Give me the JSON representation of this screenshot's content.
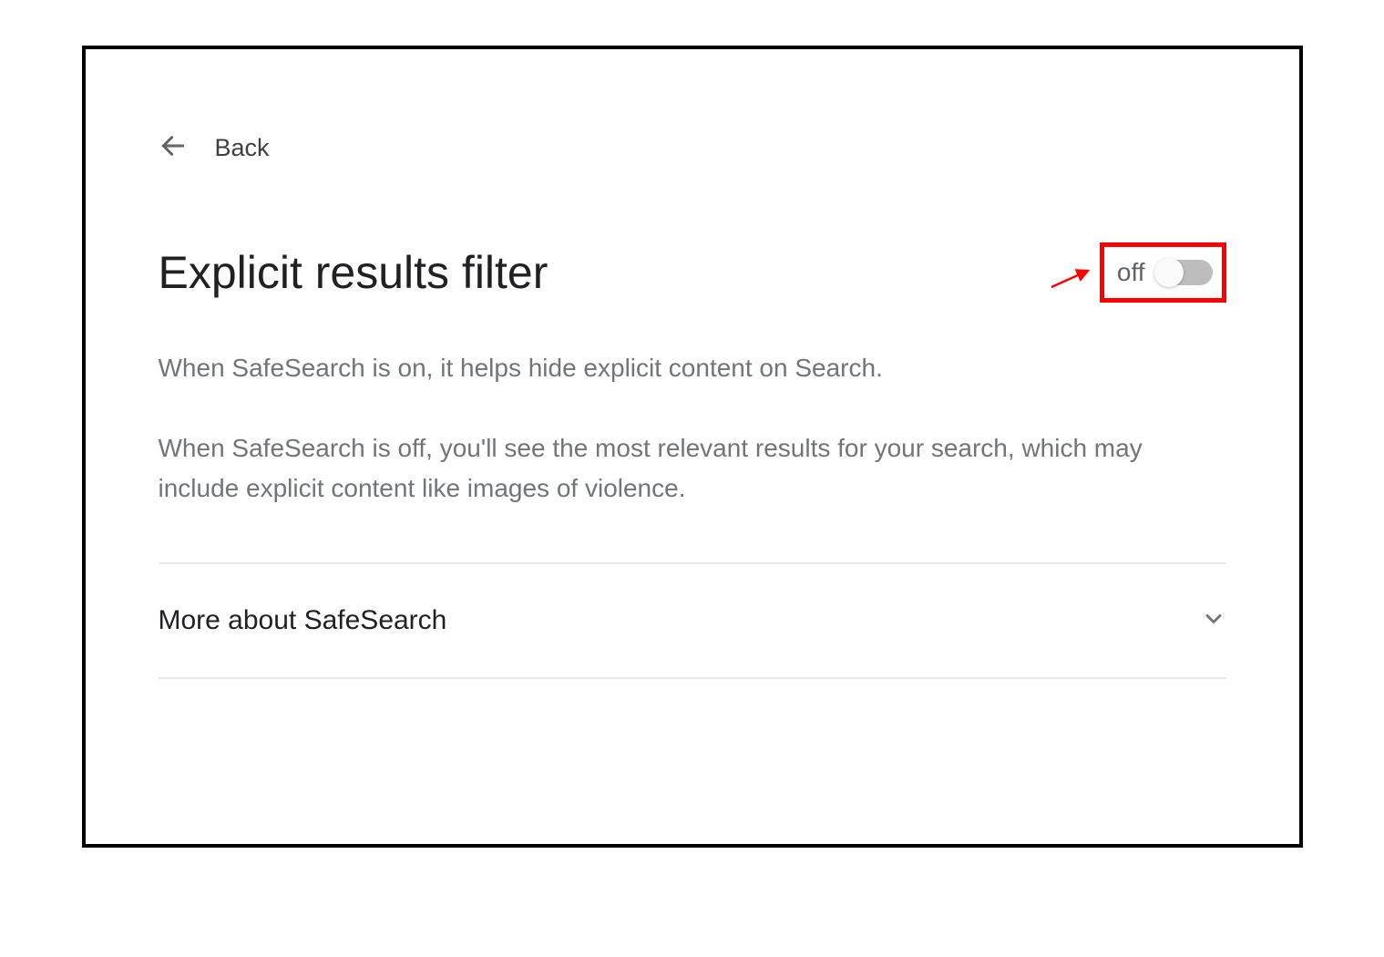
{
  "nav": {
    "back_label": "Back"
  },
  "settings": {
    "title": "Explicit results filter",
    "toggle_state_label": "off",
    "toggle_on": false,
    "description_on": "When SafeSearch is on, it helps hide explicit content on Search.",
    "description_off": "When SafeSearch is off, you'll see the most relevant results for your search, which may include explicit content like images of violence."
  },
  "expand": {
    "more_title": "More about SafeSearch"
  },
  "annotation": {
    "highlight_color": "#ff0000"
  }
}
